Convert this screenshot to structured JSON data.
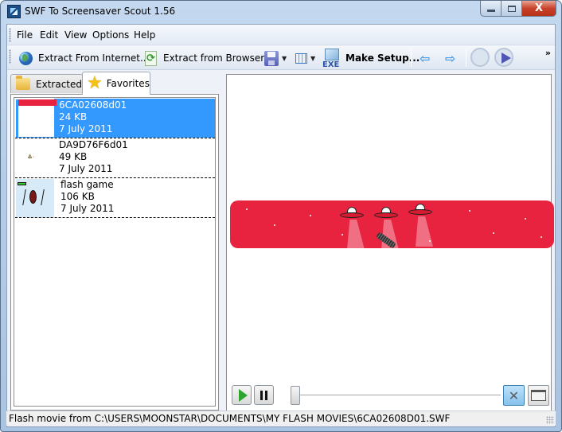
{
  "window": {
    "title": "SWF To Screensaver Scout 1.56",
    "app_icon": "swf-scout-app-icon",
    "caption_buttons": {
      "minimize": "minimize-icon",
      "maximize": "maximize-icon",
      "close": "close-icon",
      "close_glyph": "X"
    }
  },
  "menubar": {
    "items": [
      {
        "label": "File"
      },
      {
        "label": "Edit"
      },
      {
        "label": "View"
      },
      {
        "label": "Options"
      },
      {
        "label": "Help"
      }
    ]
  },
  "toolbar": {
    "extract_internet": {
      "label": "Extract From Internet..",
      "icon": "globe-icon"
    },
    "extract_browser": {
      "label": "Extract from Browser",
      "icon": "refresh-document-icon",
      "icon_glyph": "⟳"
    },
    "save": {
      "icon": "floppy-disk-icon"
    },
    "view": {
      "icon": "grid-view-icon"
    },
    "make_setup": {
      "label": "Make Setup...",
      "icon": "exe-setup-icon",
      "icon_text": "EXE"
    },
    "back": {
      "icon": "arrow-left-icon",
      "glyph": "⇦"
    },
    "forward": {
      "icon": "arrow-right-icon",
      "glyph": "⇨"
    },
    "refresh": {
      "icon": "refresh-disabled-icon"
    },
    "play_screensaver": {
      "icon": "play-screensaver-icon"
    },
    "overflow": {
      "glyph": "»"
    },
    "dropdown_glyph": "▼"
  },
  "tabs": [
    {
      "label": "Extracted",
      "icon": "folder-icon",
      "active": false
    },
    {
      "label": "Favorites",
      "icon": "star-icon",
      "icon_glyph": "★",
      "active": true
    }
  ],
  "favorites": [
    {
      "name": "6CA02608d01",
      "size": "24 KB",
      "date": "7 July 2011",
      "selected": true
    },
    {
      "name": "DA9D76F6d01",
      "size": "49 KB",
      "date": "7 July 2011",
      "selected": false
    },
    {
      "name": "flash game",
      "size": "106 KB",
      "date": "7 July 2011",
      "selected": false
    }
  ],
  "player": {
    "play_icon": "play-icon",
    "pause_icon": "pause-icon",
    "position": 0.0,
    "fit_glyph": "✕",
    "movie_colors": {
      "background": "#e8233f",
      "beam": "#f08395"
    }
  },
  "statusbar": {
    "text": "Flash movie from C:\\USERS\\MOONSTAR\\DOCUMENTS\\MY FLASH MOVIES\\6CA02608D01.SWF"
  },
  "colors": {
    "selection": "#3399ff",
    "accent_red": "#e8233f"
  }
}
